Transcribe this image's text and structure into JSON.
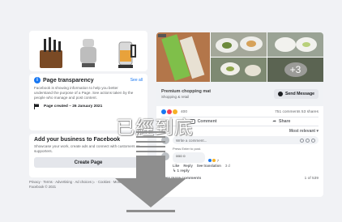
{
  "left": {
    "transparency": {
      "title": "Page transparency",
      "see_all": "See all",
      "description": "Facebook is showing information to help you better understand the purpose of a Page. See actions taken by the people who manage and post content.",
      "created": "Page created – 26 January 2021"
    },
    "business": {
      "title": "Add your business to Facebook",
      "description": "Showcase your work, create ads and connect with customers or supporters.",
      "button": "Create Page"
    },
    "footer": "Privacy · Terms · Advertising · Ad choices ▷ · Cookies · More · Facebook © 2021"
  },
  "post": {
    "more_photos": "+3",
    "title": "Premium chopping mat",
    "subtitle": "Shopping & retail",
    "send_button": "Send Message",
    "reactions_count": "400",
    "stats": "751 comments 53 shares",
    "actions": {
      "comment": "Comment",
      "share": "Share"
    },
    "sort": "Most relevant ▾",
    "comment_placeholder": "Write a comment...",
    "enter_hint": "Press Enter to post.",
    "comment_author": "ooo o",
    "comment_reaction_count": "7",
    "reply_actions": {
      "like": "Like",
      "reply": "Reply",
      "translation": "See translation",
      "time": "3 d"
    },
    "replies": "↳ 1 reply",
    "view_more": "View more comments",
    "pagination": "1 of 539"
  },
  "overlay": {
    "text": "已經到底"
  },
  "colors": {
    "accent": "#1877f2",
    "arrow": "#8e8e8e",
    "background": "#f1f2f5"
  }
}
